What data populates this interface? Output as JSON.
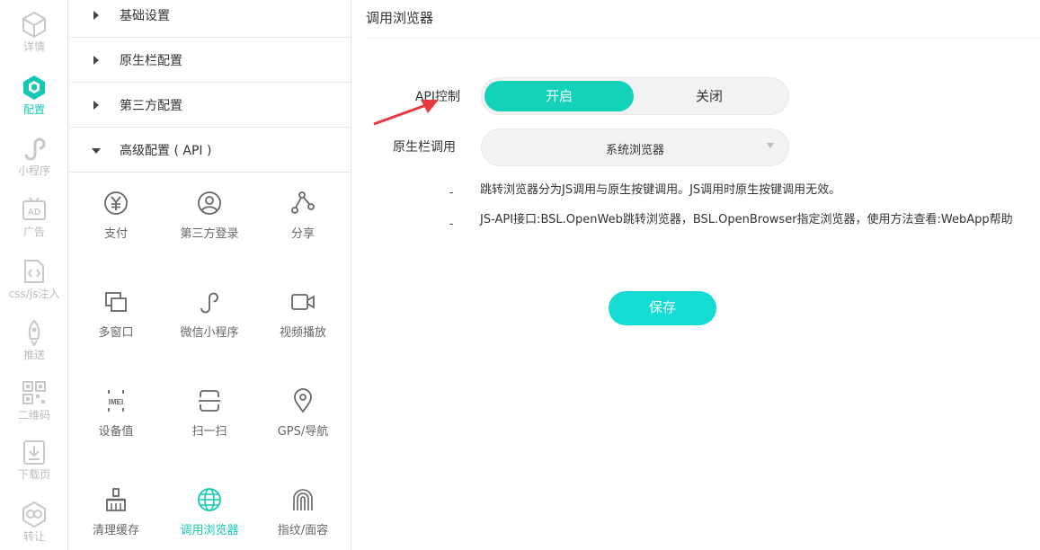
{
  "rail": {
    "items": [
      {
        "label": "详情",
        "icon": "cube-outline-icon",
        "active": false
      },
      {
        "label": "配置",
        "icon": "cube-filled-icon",
        "active": true
      },
      {
        "label": "小程序",
        "icon": "mini-program-icon",
        "active": false
      },
      {
        "label": "广告",
        "icon": "ad-icon",
        "active": false
      },
      {
        "label": "css/js注入",
        "icon": "code-file-icon",
        "active": false
      },
      {
        "label": "推送",
        "icon": "rocket-icon",
        "active": false
      },
      {
        "label": "二维码",
        "icon": "qr-code-icon",
        "active": false
      },
      {
        "label": "下载页",
        "icon": "download-page-icon",
        "active": false
      },
      {
        "label": "转让",
        "icon": "transfer-icon",
        "active": false
      }
    ]
  },
  "panel": {
    "sections": [
      {
        "label": "基础设置",
        "expanded": false
      },
      {
        "label": "原生栏配置",
        "expanded": false
      },
      {
        "label": "第三方配置",
        "expanded": false
      },
      {
        "label": "高级配置 ( API )",
        "expanded": true
      }
    ],
    "features": [
      {
        "label": "支付",
        "icon": "yen-icon"
      },
      {
        "label": "第三方登录",
        "icon": "user-circle-icon"
      },
      {
        "label": "分享",
        "icon": "share-icon"
      },
      {
        "label": "多窗口",
        "icon": "multi-window-icon"
      },
      {
        "label": "微信小程序",
        "icon": "mini-program-icon"
      },
      {
        "label": "视频播放",
        "icon": "video-icon"
      },
      {
        "label": "设备值",
        "icon": "imei-icon"
      },
      {
        "label": "扫一扫",
        "icon": "scan-icon"
      },
      {
        "label": "GPS/导航",
        "icon": "location-pin-icon"
      },
      {
        "label": "清理缓存",
        "icon": "broom-icon"
      },
      {
        "label": "调用浏览器",
        "icon": "globe-icon",
        "active": true
      },
      {
        "label": "指纹/面容",
        "icon": "fingerprint-icon"
      }
    ]
  },
  "main": {
    "title": "调用浏览器",
    "api_label": "API控制",
    "toggle_on": "开启",
    "toggle_off": "关闭",
    "native_label": "原生栏调用",
    "select_value": "系统浏览器",
    "dash1": "-",
    "dash2": "-",
    "note1": "跳转浏览器分为JS调用与原生按键调用。JS调用时原生按键调用无效。",
    "note2": "JS-API接口:BSL.OpenWeb跳转浏览器，BSL.OpenBrowser指定浏览器，使用方法查看:WebApp帮助",
    "save_label": "保存"
  },
  "colors": {
    "accent": "#14d2b9",
    "save": "#14dcd2",
    "arrow": "#e8383d",
    "rail_inactive": "#c8c8c8"
  }
}
